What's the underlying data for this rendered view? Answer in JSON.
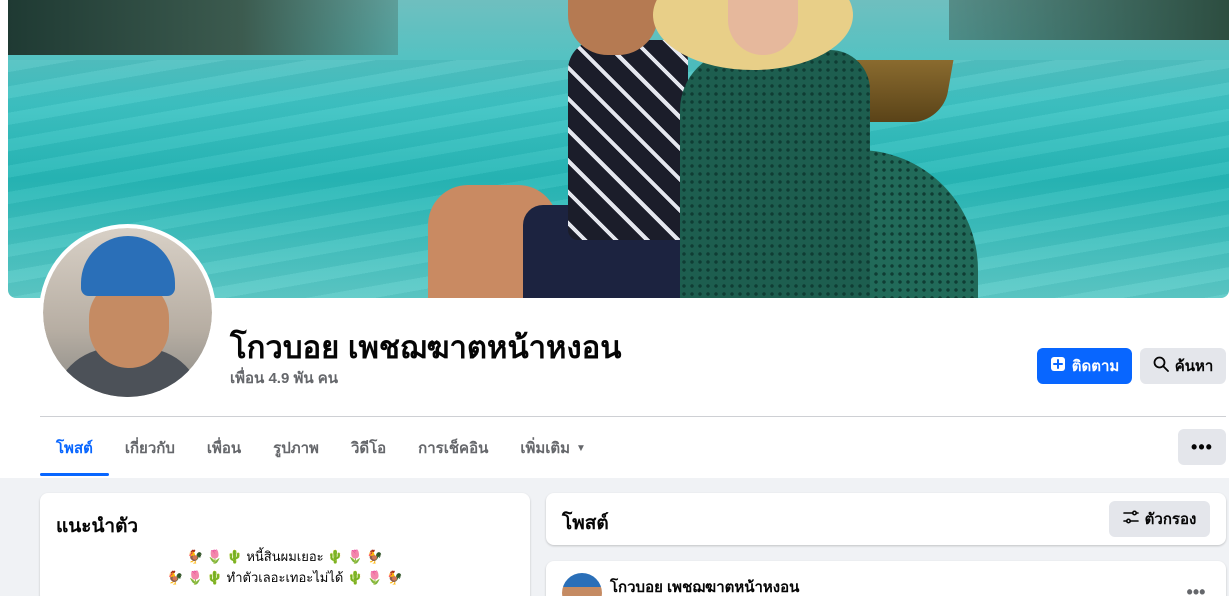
{
  "profile": {
    "name": "โกวบอย เพชฌฆาตหน้าหงอน",
    "friends": "เพื่อน 4.9 พัน คน"
  },
  "actions": {
    "follow_label": "ติดตาม",
    "search_label": "ค้นหา",
    "more_label": "•••"
  },
  "tabs": [
    {
      "label": "โพสต์"
    },
    {
      "label": "เกี่ยวกับ"
    },
    {
      "label": "เพื่อน"
    },
    {
      "label": "รูปภาพ"
    },
    {
      "label": "วิดีโอ"
    },
    {
      "label": "การเช็คอิน"
    },
    {
      "label": "เพิ่มเติม"
    }
  ],
  "intro": {
    "title": "แนะนำตัว",
    "bio_line1": "🐓 🌷 🌵 หนี้สินผมเยอะ 🌵 🌷 🐓",
    "bio_line2": "🐓 🌷 🌵 ทำตัวเลอะเทอะไม่ได้ 🌵 🌷 🐓"
  },
  "posts": {
    "title": "โพสต์",
    "filter_label": "ตัวกรอง",
    "first_post_author": "โกวบอย เพชฌฆาตหน้าหงอน",
    "post_menu_label": "•••"
  },
  "colors": {
    "accent": "#0866ff",
    "page_bg": "#f0f2f5",
    "secondary_button": "#e4e6eb",
    "muted_text": "#65676b"
  }
}
